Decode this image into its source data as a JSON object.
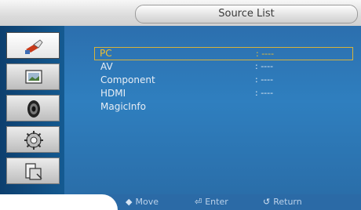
{
  "window": {
    "title": "Source List"
  },
  "sidebar": {
    "items": [
      {
        "icon": "input-plug-icon",
        "active": true
      },
      {
        "icon": "picture-icon",
        "active": false
      },
      {
        "icon": "sound-icon",
        "active": false
      },
      {
        "icon": "setup-gear-icon",
        "active": false
      },
      {
        "icon": "multi-control-icon",
        "active": false
      }
    ]
  },
  "source_list": {
    "items": [
      {
        "label": "PC",
        "value": ": ----",
        "selected": true
      },
      {
        "label": "AV",
        "value": ": ----",
        "selected": false
      },
      {
        "label": "Component",
        "value": ": ----",
        "selected": false
      },
      {
        "label": "HDMI",
        "value": ": ----",
        "selected": false
      },
      {
        "label": "MagicInfo",
        "value": "",
        "selected": false
      }
    ]
  },
  "footer": {
    "move_label": "Move",
    "enter_label": "Enter",
    "return_label": "Return"
  }
}
